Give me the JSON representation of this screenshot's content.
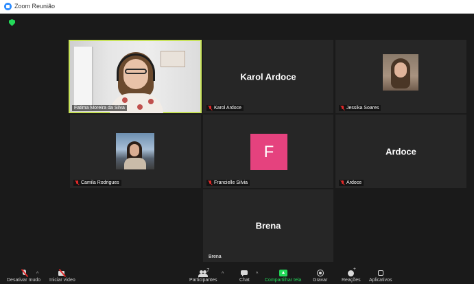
{
  "window": {
    "title": "Zoom Reunião"
  },
  "colors": {
    "active_speaker": "#c8e35a",
    "avatar_f": "#e5427e",
    "share_green": "#23d959",
    "mute_red": "#e02828"
  },
  "tiles": {
    "fatima": {
      "name": "Fatima Moreira da Silva"
    },
    "karol": {
      "name": "Karol Ardoce",
      "center_name": "Karol Ardoce"
    },
    "jessika": {
      "name": "Jessika Soares"
    },
    "camila": {
      "name": "Camila Rodrigues"
    },
    "francielle": {
      "name": "Francielle Silvia",
      "avatar_letter": "F"
    },
    "ardoce": {
      "name": "Ardoce",
      "center_name": "Ardoce"
    },
    "brena": {
      "name": "Brena",
      "center_name": "Brena"
    }
  },
  "toolbar": {
    "mute_label": "Desativar mudo",
    "video_label": "Iniciar vídeo",
    "participants_label": "Participantes",
    "participants_count": "7",
    "chat_label": "Chat",
    "share_label": "Compartilhar tela",
    "record_label": "Gravar",
    "reactions_label": "Reações",
    "apps_label": "Aplicativos"
  },
  "icons": [
    "zoom-app-icon",
    "security-shield-icon",
    "mic-muted-icon",
    "video-off-icon",
    "participants-icon",
    "chat-icon",
    "share-screen-icon",
    "record-icon",
    "reactions-icon",
    "apps-icon"
  ]
}
